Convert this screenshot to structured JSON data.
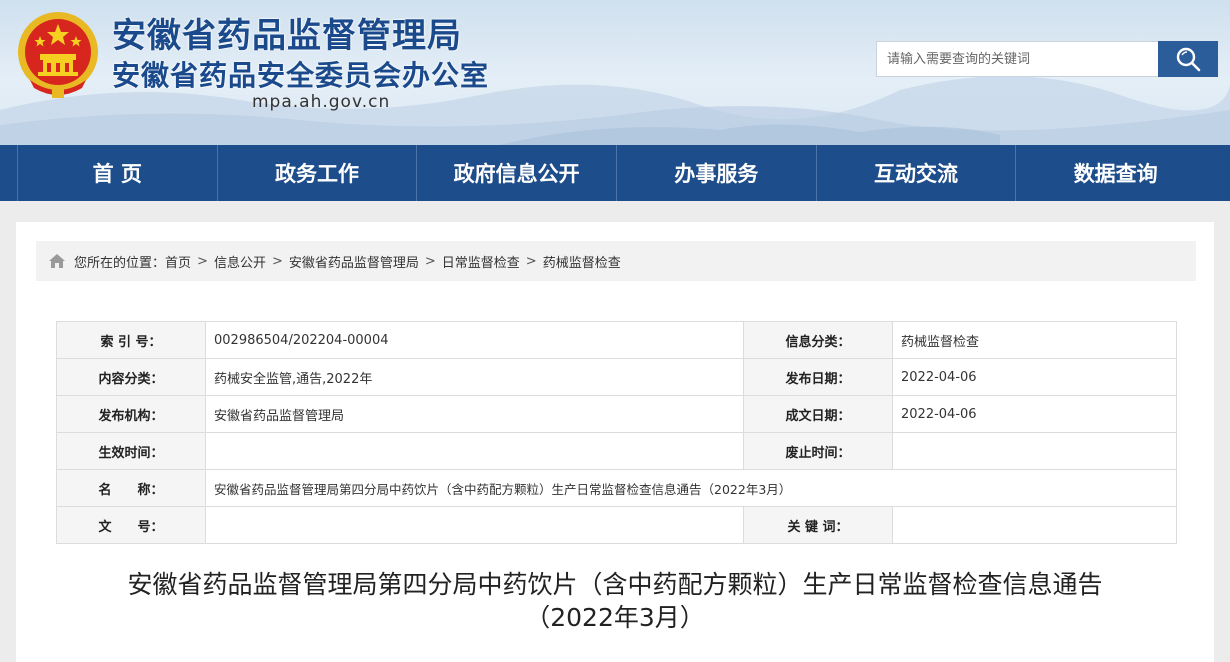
{
  "header": {
    "title_line1": "安徽省药品监督管理局",
    "title_line2": "安徽省药品安全委员会办公室",
    "domain": "mpa.ah.gov.cn",
    "emblem_icon": "national-emblem-icon",
    "search": {
      "placeholder": "请输入需要查询的关键词",
      "value": "",
      "button_icon": "search-icon"
    }
  },
  "nav": {
    "items": [
      "首 页",
      "政务工作",
      "政府信息公开",
      "办事服务",
      "互动交流",
      "数据查询"
    ]
  },
  "breadcrumb": {
    "prefix": "您所在的位置：",
    "items": [
      "首页",
      "信息公开",
      "安徽省药品监督管理局",
      "日常监督检查",
      "药械监督检查"
    ],
    "separator": ">"
  },
  "meta": {
    "index_label": "索 引 号：",
    "index_value": "002986504/202204-00004",
    "category_label": "信息分类：",
    "category_value": "药械监督检查",
    "content_label": "内容分类：",
    "content_value": "药械安全监管,通告,2022年",
    "publish_label": "发布日期：",
    "publish_value": "2022-04-06",
    "org_label": "发布机构：",
    "org_value": "安徽省药品监督管理局",
    "written_label": "成文日期：",
    "written_value": "2022-04-06",
    "effective_label": "生效时间：",
    "effective_value": "",
    "abolish_label": "废止时间：",
    "abolish_value": "",
    "name_label": "名　　称：",
    "name_value": "安徽省药品监督管理局第四分局中药饮片（含中药配方颗粒）生产日常监督检查信息通告（2022年3月）",
    "docno_label": "文　　号：",
    "docno_value": "",
    "keywords_label": "关 键 词：",
    "keywords_value": ""
  },
  "article": {
    "title_line1": "安徽省药品监督管理局第四分局中药饮片（含中药配方颗粒）生产日常监督检查信息通告",
    "title_line2": "（2022年3月）"
  },
  "colors": {
    "brand_blue": "#1d4d8a",
    "title_blue": "#1a4a8c",
    "search_blue": "#2b5d9a"
  }
}
